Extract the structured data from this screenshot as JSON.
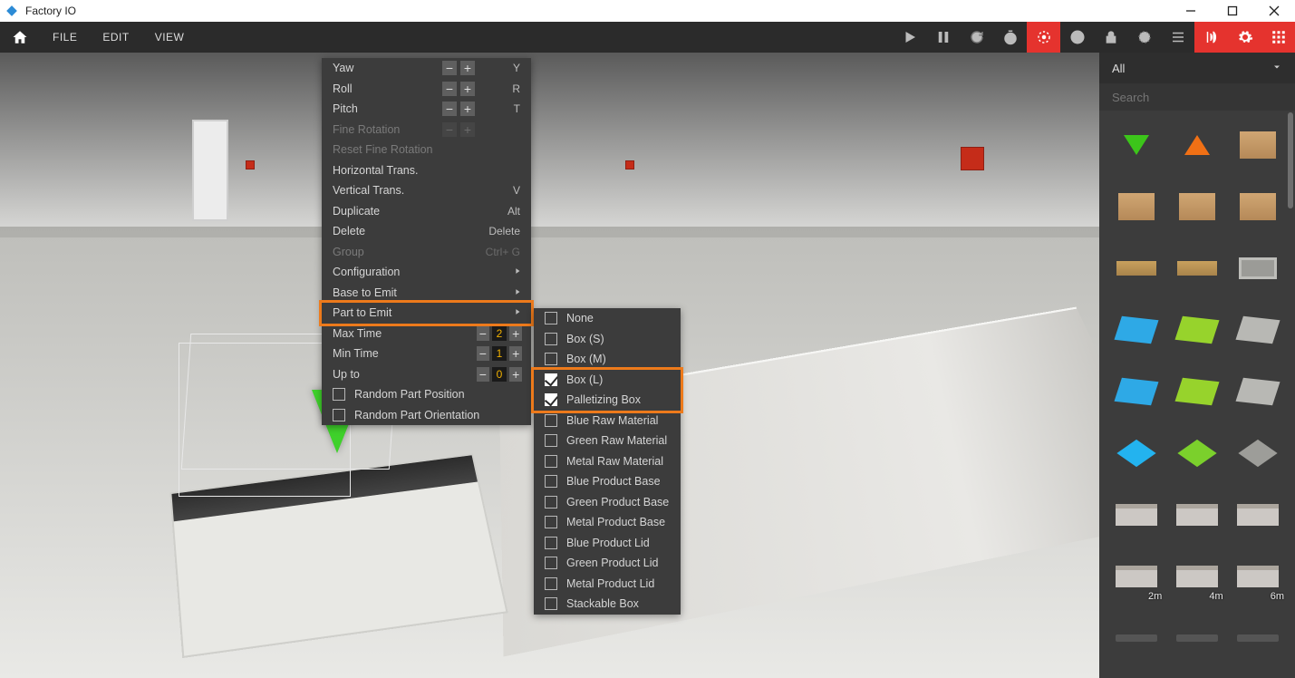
{
  "app": {
    "title": "Factory IO"
  },
  "menu": {
    "file": "FILE",
    "edit": "EDIT",
    "view": "VIEW"
  },
  "context_menu": {
    "items": [
      {
        "label": "Yaw",
        "hotkey": "Y",
        "step": true
      },
      {
        "label": "Roll",
        "hotkey": "R",
        "step": true
      },
      {
        "label": "Pitch",
        "hotkey": "T",
        "step": true
      },
      {
        "label": "Fine Rotation",
        "hotkey": "",
        "step": true,
        "disabled": true
      },
      {
        "label": "Reset Fine Rotation",
        "hotkey": "",
        "disabled": true
      },
      {
        "label": "Horizontal Trans.",
        "hotkey": ""
      },
      {
        "label": "Vertical Trans.",
        "hotkey": "V"
      },
      {
        "label": "Duplicate",
        "hotkey": "Alt"
      },
      {
        "label": "Delete",
        "hotkey": "Delete"
      },
      {
        "label": "Group",
        "hotkey": "Ctrl+ G",
        "disabled": true
      },
      {
        "label": "Configuration",
        "submenu": true
      },
      {
        "label": "Base to Emit",
        "submenu": true
      },
      {
        "label": "Part to Emit",
        "submenu": true,
        "highlight": true
      },
      {
        "label": "Max Time",
        "numeric": "2"
      },
      {
        "label": "Min Time",
        "numeric": "1"
      },
      {
        "label": "Up to",
        "numeric": "0"
      },
      {
        "label": "Random Part Position",
        "checkbox": true
      },
      {
        "label": "Random Part Orientation",
        "checkbox": true
      }
    ],
    "sub_parts": [
      {
        "label": "None",
        "checked": false
      },
      {
        "label": "Box (S)",
        "checked": false
      },
      {
        "label": "Box (M)",
        "checked": false
      },
      {
        "label": "Box (L)",
        "checked": true,
        "highlight": true
      },
      {
        "label": "Palletizing Box",
        "checked": true,
        "highlight": true
      },
      {
        "label": "Blue Raw Material",
        "checked": false
      },
      {
        "label": "Green Raw Material",
        "checked": false
      },
      {
        "label": "Metal Raw Material",
        "checked": false
      },
      {
        "label": "Blue Product Base",
        "checked": false
      },
      {
        "label": "Green Product Base",
        "checked": false
      },
      {
        "label": "Metal Product Base",
        "checked": false
      },
      {
        "label": "Blue Product Lid",
        "checked": false
      },
      {
        "label": "Green Product Lid",
        "checked": false
      },
      {
        "label": "Metal Product Lid",
        "checked": false
      },
      {
        "label": "Stackable Box",
        "checked": false
      }
    ]
  },
  "palette": {
    "filter": "All",
    "search_placeholder": "Search",
    "items": [
      {
        "name": "emitter",
        "shape": "arrowdown"
      },
      {
        "name": "remover",
        "shape": "arrowup"
      },
      {
        "name": "box-s",
        "shape": "boxshape"
      },
      {
        "name": "box-m",
        "shape": "boxshape"
      },
      {
        "name": "box-l",
        "shape": "boxshape"
      },
      {
        "name": "palletizing-box",
        "shape": "boxshape"
      },
      {
        "name": "pallet-1",
        "shape": "pallet"
      },
      {
        "name": "pallet-2",
        "shape": "pallet"
      },
      {
        "name": "crate",
        "shape": "crate"
      },
      {
        "name": "blue-raw",
        "shape": "plate pb"
      },
      {
        "name": "green-raw",
        "shape": "plate pg"
      },
      {
        "name": "metal-raw",
        "shape": "plate pgr"
      },
      {
        "name": "blue-base",
        "shape": "plate pb"
      },
      {
        "name": "green-base",
        "shape": "plate pg"
      },
      {
        "name": "metal-base",
        "shape": "plate pgr"
      },
      {
        "name": "blue-lid",
        "shape": "cube cb"
      },
      {
        "name": "green-lid",
        "shape": "cube cg"
      },
      {
        "name": "metal-lid",
        "shape": "cube cgr"
      },
      {
        "name": "conveyor-a",
        "shape": "convthumb"
      },
      {
        "name": "conveyor-b",
        "shape": "convthumb"
      },
      {
        "name": "conveyor-c",
        "shape": "convthumb"
      },
      {
        "name": "roller-2m",
        "shape": "convthumb",
        "label": "2m"
      },
      {
        "name": "roller-4m",
        "shape": "convthumb",
        "label": "4m"
      },
      {
        "name": "roller-6m",
        "shape": "convthumb",
        "label": "6m"
      },
      {
        "name": "rail-1",
        "shape": "rail"
      },
      {
        "name": "rail-2",
        "shape": "rail"
      },
      {
        "name": "rail-3",
        "shape": "rail"
      }
    ]
  }
}
